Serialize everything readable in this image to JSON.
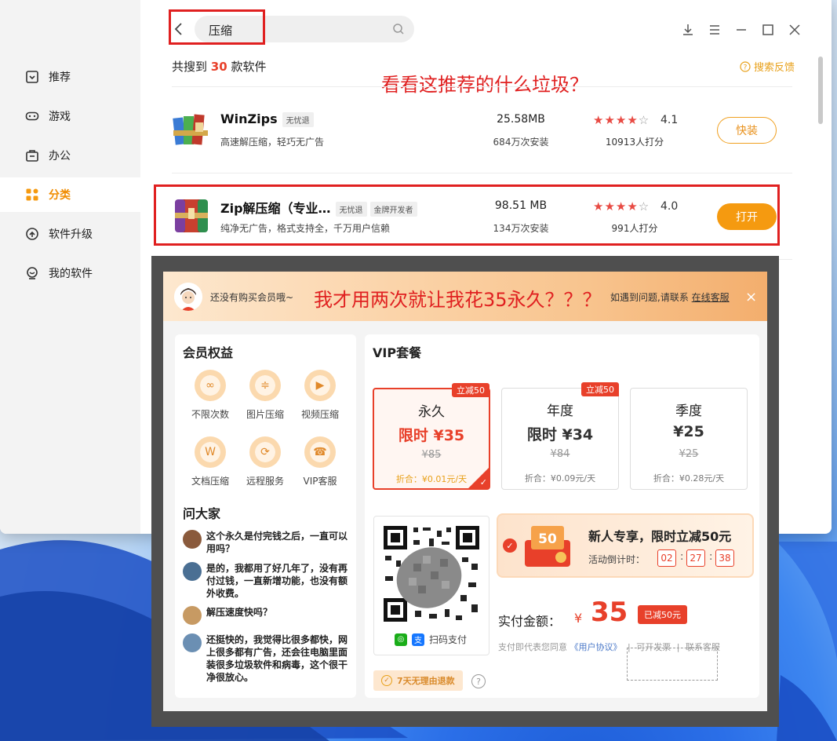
{
  "sidebar": {
    "items": [
      {
        "label": "推荐",
        "icon": "recommend-icon"
      },
      {
        "label": "游戏",
        "icon": "gamepad-icon"
      },
      {
        "label": "办公",
        "icon": "briefcase-icon"
      },
      {
        "label": "分类",
        "icon": "category-grid-icon",
        "active": true
      },
      {
        "label": "软件升级",
        "icon": "upgrade-icon"
      },
      {
        "label": "我的软件",
        "icon": "my-software-icon"
      }
    ]
  },
  "search": {
    "query": "压缩"
  },
  "results": {
    "prefix": "共搜到",
    "count": "30",
    "suffix": "款软件",
    "feedback": "搜索反馈"
  },
  "annotations": {
    "top": "看看这推荐的什么垃圾？",
    "modal": "我才用两次就让我花35永久？？？"
  },
  "apps": [
    {
      "name": "WinZips",
      "tags": [
        "无忧退"
      ],
      "desc": "高速解压缩，轻巧无广告",
      "size": "25.58MB",
      "installs": "684万次安装",
      "rating": "4.1",
      "stars": 4,
      "raters": "10913人打分",
      "action": "快装"
    },
    {
      "name": "Zip解压缩（专业…",
      "tags": [
        "无忧退",
        "金牌开发者"
      ],
      "desc": "纯净无广告，格式支持全，千万用户信赖",
      "size": "98.51 MB",
      "installs": "134万次安装",
      "rating": "4.0",
      "stars": 4,
      "raters": "991人打分",
      "action": "打开"
    }
  ],
  "modal": {
    "tip": "还没有购买会员哦~",
    "help_prefix": "如遇到问题,请联系",
    "help_link": "在线客服",
    "close": "×",
    "benefits_title": "会员权益",
    "benefits": [
      {
        "label": "不限次数",
        "icon": "infinity-icon",
        "glyph": "∞"
      },
      {
        "label": "图片压缩",
        "icon": "image-compress-icon",
        "glyph": "≑"
      },
      {
        "label": "视频压缩",
        "icon": "video-icon",
        "glyph": "▶"
      },
      {
        "label": "文档压缩",
        "icon": "document-icon",
        "glyph": "W"
      },
      {
        "label": "远程服务",
        "icon": "remote-service-icon",
        "glyph": "⟳"
      },
      {
        "label": "VIP客服",
        "icon": "support-icon",
        "glyph": "☎"
      }
    ],
    "qa_title": "问大家",
    "qa": [
      "这个永久是付完钱之后，一直可以用吗？",
      "是的，我都用了好几年了，没有再付过钱，一直新增功能，也没有额外收费。",
      "解压速度快吗？",
      "还挺快的，我觉得比很多都快，网上很多都有广告，还会往电脑里面装很多垃圾软件和病毒，这个很干净很放心。"
    ],
    "vip_title": "VIP套餐",
    "plans": [
      {
        "name": "永久",
        "price": "限时 ¥35",
        "orig": "¥85",
        "disc": "折合：¥0.01元/天",
        "badge": "立减50",
        "selected": true
      },
      {
        "name": "年度",
        "price": "限时 ¥34",
        "orig": "¥84",
        "disc": "折合：¥0.09元/天",
        "badge": "立减50",
        "selected": false
      },
      {
        "name": "季度",
        "price": "¥25",
        "orig": "¥25",
        "disc": "折合：¥0.28元/天",
        "badge": "",
        "selected": false
      }
    ],
    "scan_pay": "扫码支付",
    "promo": {
      "badge": "50",
      "title": "新人专享，限时立减50元",
      "countdown_label": "活动倒计时：",
      "h": "02",
      "m": "27",
      "s": "38"
    },
    "pay": {
      "label": "实付金额：",
      "currency": "¥",
      "amount": "35",
      "saved": "已减50元"
    },
    "agreement": {
      "prefix": "支付即代表您同意",
      "link": "《用户协议》",
      "invoice": "可开发票",
      "service": "联系客服"
    },
    "refund": "7天无理由退款",
    "help_q": "?"
  },
  "colors": {
    "accent": "#f59a10",
    "red": "#e8402a",
    "annotation": "#e02020"
  }
}
